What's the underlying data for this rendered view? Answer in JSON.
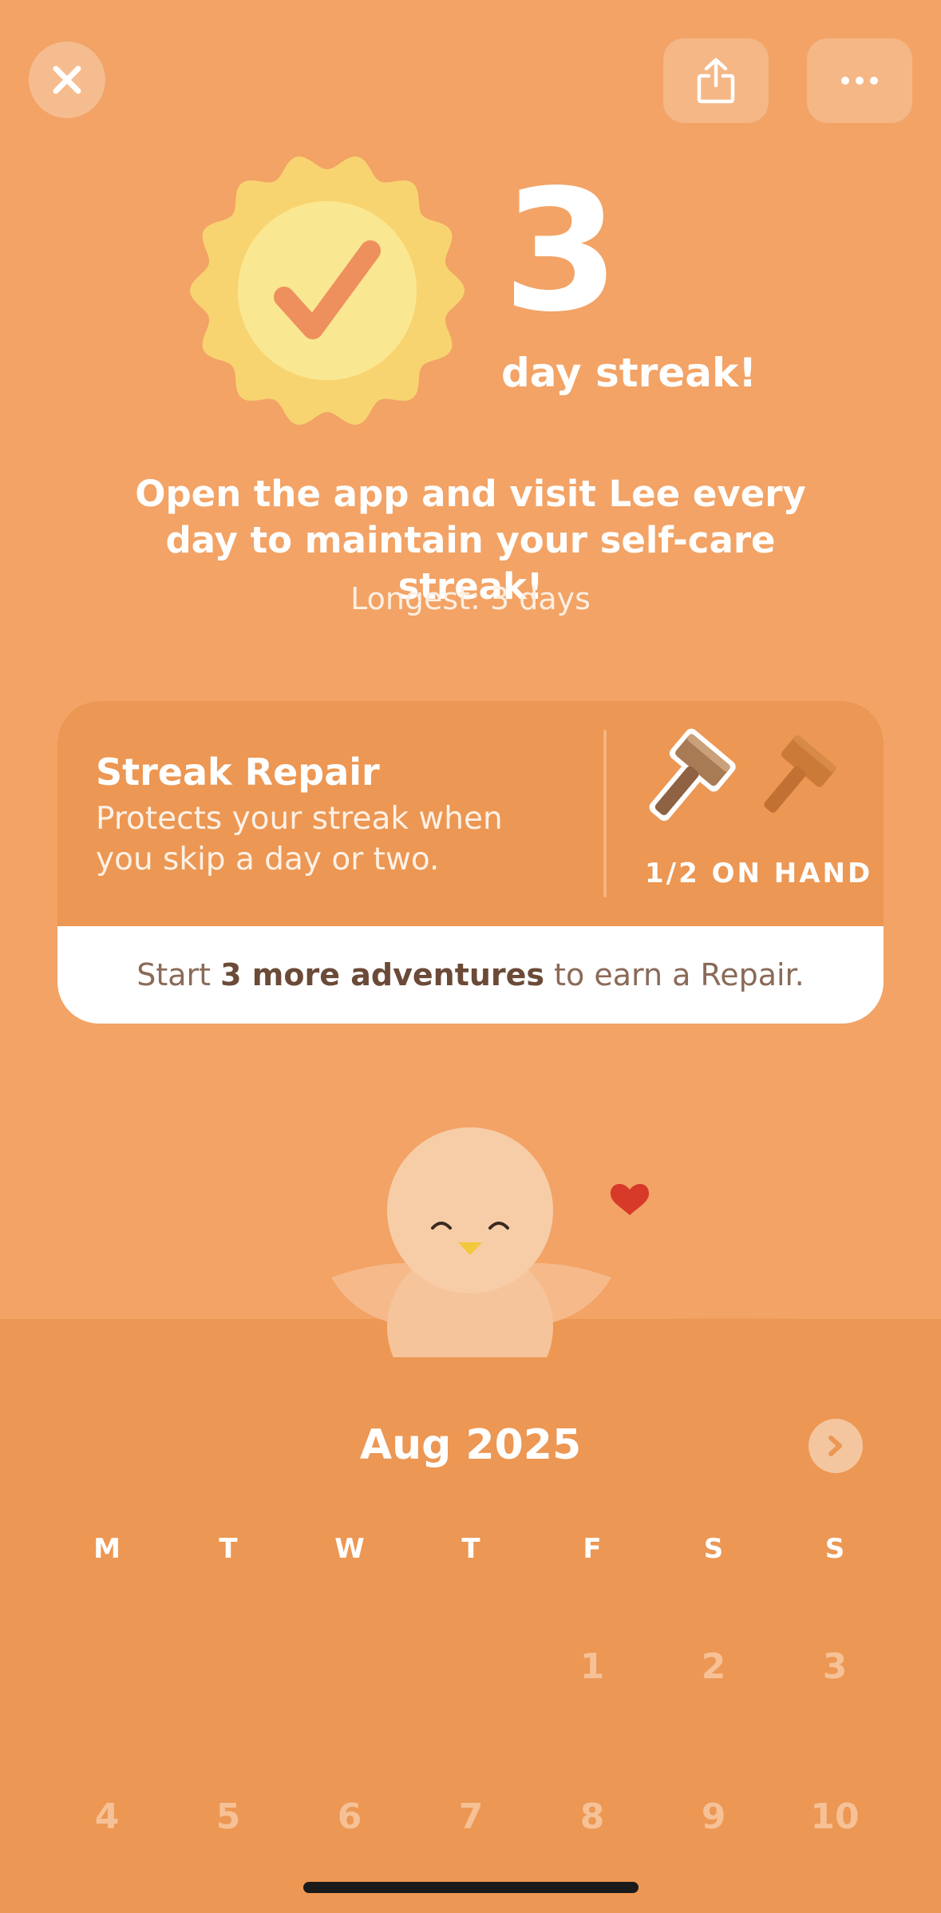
{
  "header": {
    "close_icon": "close-icon",
    "share_icon": "share-icon",
    "more_icon": "more-icon"
  },
  "streak": {
    "count": "3",
    "label": "day streak!",
    "description": "Open the app and visit Lee every day to maintain your self-care streak!",
    "longest": "Longest: 3 days"
  },
  "repair_card": {
    "title": "Streak Repair",
    "subtitle": "Protects your streak when you skip a day or two.",
    "on_hand": "1/2 ON HAND",
    "cta_prefix": "Start ",
    "cta_bold": "3 more adventures",
    "cta_suffix": " to earn a Repair."
  },
  "calendar": {
    "month": "Aug 2025",
    "weekdays": [
      "M",
      "T",
      "W",
      "T",
      "F",
      "S",
      "S"
    ],
    "weeks": [
      [
        "",
        "",
        "",
        "",
        "1",
        "2",
        "3"
      ],
      [
        "4",
        "5",
        "6",
        "7",
        "8",
        "9",
        "10"
      ]
    ]
  },
  "colors": {
    "background": "#F2A365",
    "card_top": "#EC9753",
    "badge_sun": "#F8D470",
    "check": "#EE8F5E"
  }
}
